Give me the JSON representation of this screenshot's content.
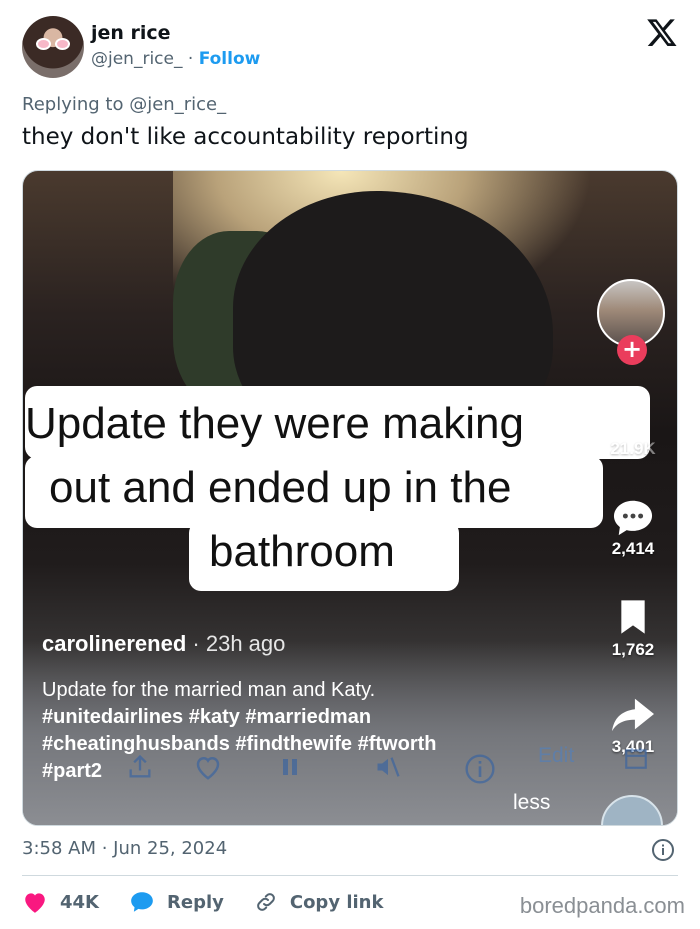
{
  "author": {
    "name": "jen rice",
    "handle": "@jen_rice_",
    "separator": "·",
    "follow_label": "Follow"
  },
  "reply": {
    "prefix": "Replying to",
    "mention": "@jen_rice_"
  },
  "tweet_text": "they don't like accountability reporting",
  "media": {
    "caption_lines": [
      "Update they were making",
      "out and ended up in the",
      "bathroom"
    ],
    "tiktok_user": "carolinerened",
    "tiktok_time": "23h ago",
    "tiktok_dot": "·",
    "description": "Update for the married man and Katy.",
    "hashtags_line1": "#unitedairlines #katy #marriedman",
    "hashtags_line2": "#cheatinghusbands #findthewife #ftworth",
    "hashtags_line3": "#part2",
    "less_label": "less",
    "edit_label": "Edit",
    "likes": "21.9K",
    "comments": "2,414",
    "saves": "1,762",
    "shares": "3,401"
  },
  "timestamp": "3:58 AM · Jun 25, 2024",
  "actions": {
    "like_count": "44K",
    "reply_label": "Reply",
    "copy_label": "Copy link"
  },
  "watermark": "boredpanda.com",
  "colors": {
    "link_blue": "#1d9bf0",
    "like_red": "#f91880",
    "text_gray": "#536471",
    "tiktok_red": "#ea3d5c"
  }
}
